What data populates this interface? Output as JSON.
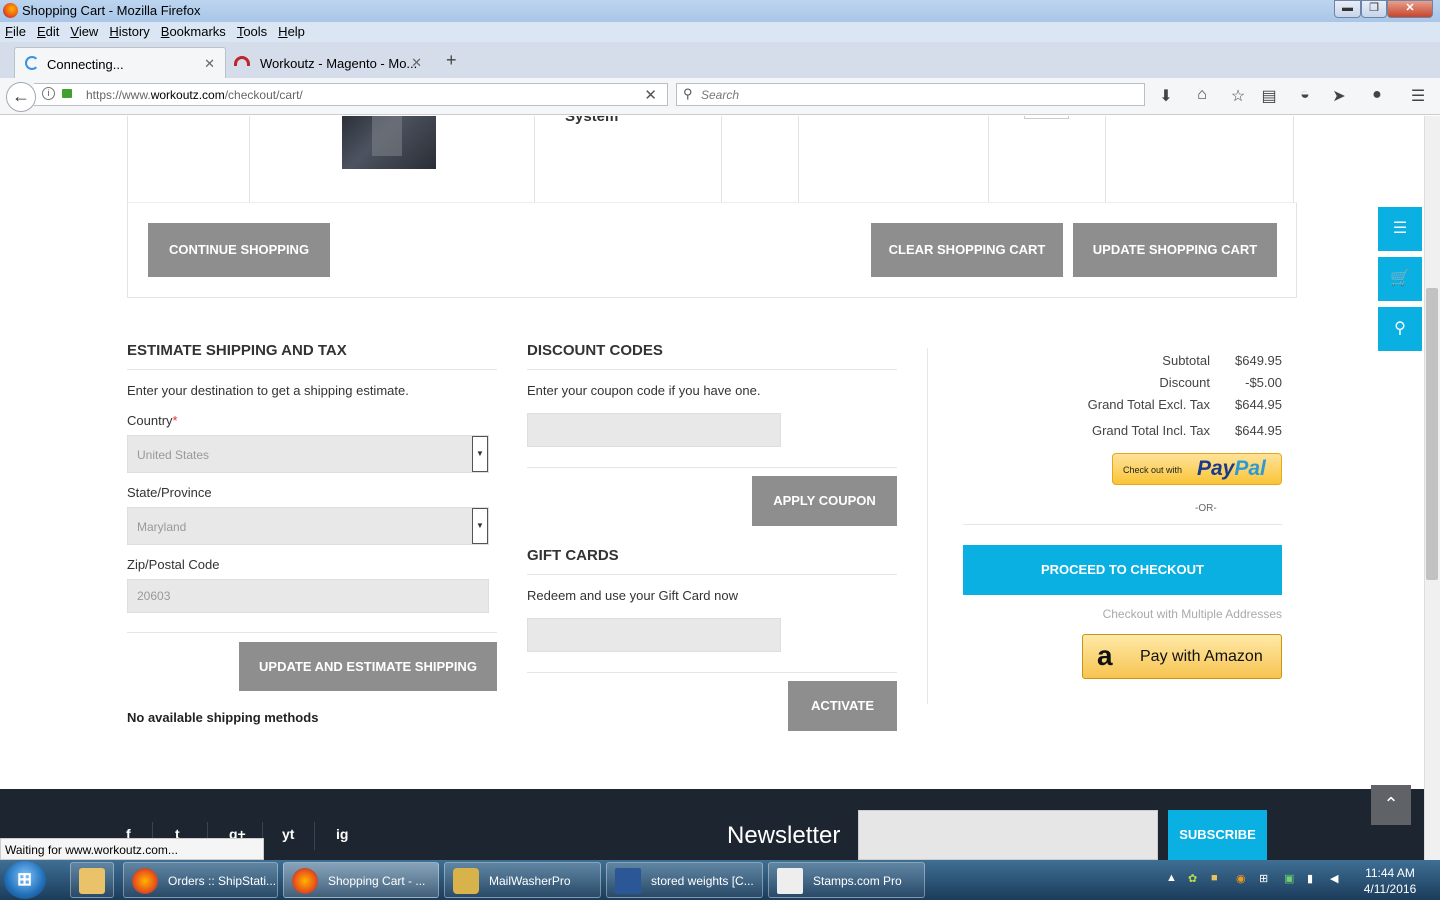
{
  "window": {
    "title": "Shopping Cart - Mozilla Firefox",
    "min": "▬",
    "max": "❐",
    "close": "✕"
  },
  "menu": [
    "File",
    "Edit",
    "View",
    "History",
    "Bookmarks",
    "Tools",
    "Help"
  ],
  "tabs": [
    {
      "label": "Connecting...",
      "close": "✕"
    },
    {
      "label": "Workoutz - Magento - Mo...",
      "close": "✕"
    }
  ],
  "newtab": "+",
  "nav": {
    "url_prefix": "https://www.",
    "url_host": "workoutz.com",
    "url_path": "/checkout/cart/",
    "search_placeholder": "Search"
  },
  "cart": {
    "product_name_fragment": "System",
    "continue_label": "Continue Shopping",
    "clear_label": "Clear Shopping Cart",
    "update_label": "Update Shopping Cart"
  },
  "shipping": {
    "title": "Estimate Shipping and Tax",
    "intro": "Enter your destination to get a shipping estimate.",
    "country_label": "Country",
    "required_mark": "*",
    "country_value": "United States",
    "state_label": "State/Province",
    "state_value": "Maryland",
    "zip_label": "Zip/Postal Code",
    "zip_value": "20603",
    "button": "Update and Estimate Shipping",
    "message": "No available shipping methods"
  },
  "discount": {
    "title": "Discount Codes",
    "intro": "Enter your coupon code if you have one.",
    "button": "Apply Coupon"
  },
  "giftcards": {
    "title": "Gift Cards",
    "intro": "Redeem and use your Gift Card now",
    "button": "Activate"
  },
  "totals": {
    "subtotal_label": "Subtotal",
    "subtotal": "$649.95",
    "discount_label": "Discount",
    "discount": "-$5.00",
    "excl_label": "Grand Total Excl. Tax",
    "excl": "$644.95",
    "incl_label": "Grand Total Incl. Tax",
    "incl": "$644.95",
    "paypal_small": "Check out with",
    "paypal_pay": "Pay",
    "paypal_pal": "Pal",
    "or": "-OR-",
    "proceed": "Proceed to Checkout",
    "multi": "Checkout with Multiple Addresses",
    "amazon_logo": "a",
    "amazon": "Pay with Amazon"
  },
  "footer": {
    "newsletter": "Newsletter",
    "subscribe": "Subscribe",
    "social": [
      "f",
      "t",
      "g+",
      "yt",
      "ig"
    ]
  },
  "status": "Waiting for www.workoutz.com...",
  "taskbar": {
    "items": [
      "Orders :: ShipStati...",
      "Shopping Cart - ...",
      "MailWasherPro",
      "stored weights [C...",
      "Stamps.com Pro"
    ],
    "time": "11:44 AM",
    "date": "4/11/2016"
  }
}
